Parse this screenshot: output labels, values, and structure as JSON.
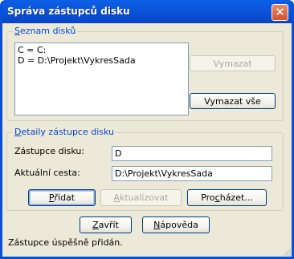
{
  "window": {
    "title": "Správa zástupců disku",
    "close_symbol": "✕"
  },
  "drive_list_group": {
    "legend_prefix": "",
    "legend_accel": "S",
    "legend_rest": "eznam disků",
    "items": [
      "C = C:",
      "D = D:\\Projekt\\VykresSada"
    ],
    "delete_button": "Vymazat",
    "delete_all_button": "Vymazat vše"
  },
  "details_group": {
    "legend_prefix": "",
    "legend_accel": "D",
    "legend_rest": "etaily zástupce disku",
    "drive_label": "Zástupce disku:",
    "drive_value": "D",
    "path_label": "Aktuální cesta:",
    "path_value": "D:\\Projekt\\VykresSada",
    "add_button_accel": "P",
    "add_button_rest": "řidat",
    "update_button_prefix": "",
    "update_button_accel": "A",
    "update_button_rest": "ktualizovat",
    "browse_button_prefix": "Pro",
    "browse_button_accel": "c",
    "browse_button_rest": "házet..."
  },
  "footer": {
    "close_button_accel": "Z",
    "close_button_rest": "avřít",
    "help_button_prefix": "",
    "help_button_accel": "N",
    "help_button_rest": "ápověda",
    "status_text": "Zástupce úspěšně přidán."
  },
  "colors": {
    "title_bar": "#0a55dc",
    "dialog_background": "#ece9d8",
    "group_legend": "#0046d5",
    "close_button": "#d6502a"
  }
}
